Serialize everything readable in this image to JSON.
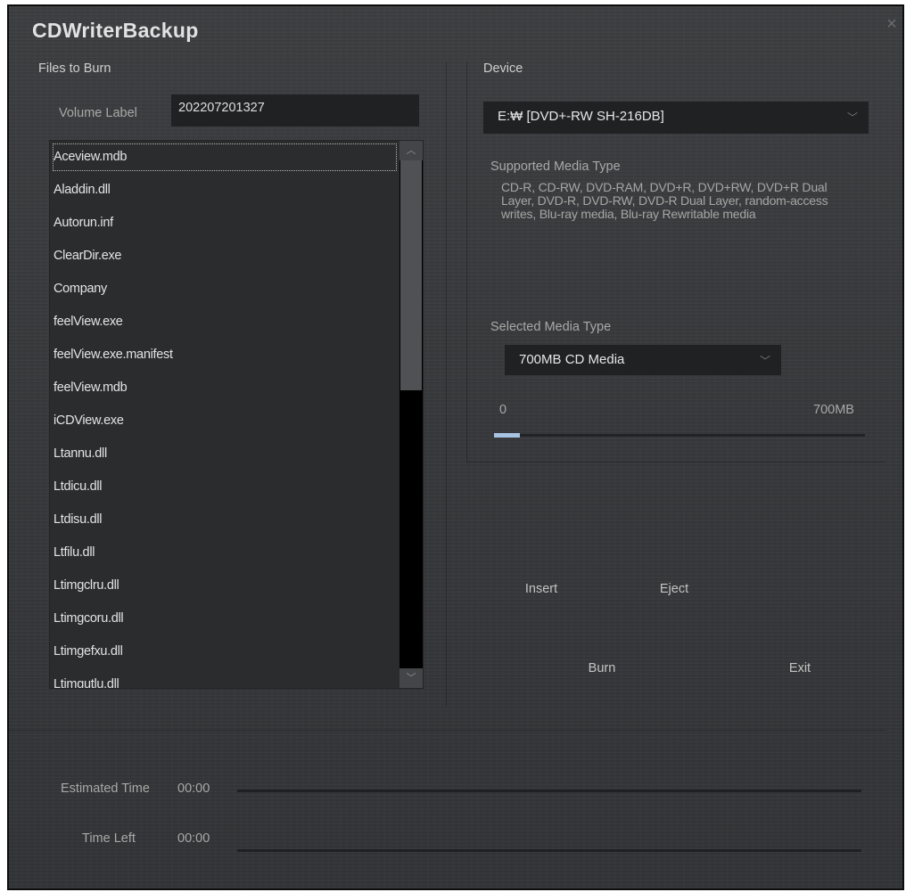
{
  "window": {
    "title": "CDWriterBackup",
    "close_glyph": "×"
  },
  "files": {
    "section_label": "Files to Burn",
    "volume_label": "Volume Label",
    "volume_value": "202207201327",
    "items": [
      "Aceview.mdb",
      "Aladdin.dll",
      "Autorun.inf",
      "ClearDir.exe",
      "Company",
      "feelView.exe",
      "feelView.exe.manifest",
      "feelView.mdb",
      "iCDView.exe",
      "Ltannu.dll",
      "Ltdicu.dll",
      "Ltdisu.dll",
      "Ltfilu.dll",
      "Ltimgclru.dll",
      "Ltimgcoru.dll",
      "Ltimgefxu.dll",
      "Ltimgutlu.dll"
    ],
    "scroll_up_glyph": "︿",
    "scroll_down_glyph": "﹀"
  },
  "device": {
    "section_label": "Device",
    "selected": "E:₩ [DVD+-RW SH-216DB]",
    "supported_label": "Supported Media Type",
    "supported_text": "CD-R, CD-RW, DVD-RAM, DVD+R, DVD+RW, DVD+R Dual Layer, DVD-R, DVD-RW, DVD-R Dual Layer, random-access writes, Blu-ray media, Blu-ray Rewritable media",
    "selected_media_label": "Selected Media Type",
    "selected_media": "700MB CD Media",
    "capacity_min": "0",
    "capacity_max": "700MB",
    "capacity_used_fraction": 0.07,
    "chevron_glyph": "﹀"
  },
  "buttons": {
    "insert": "Insert",
    "eject": "Eject",
    "burn": "Burn",
    "exit": "Exit"
  },
  "progress": {
    "estimated_label": "Estimated Time",
    "estimated_value": "00:00",
    "left_label": "Time Left",
    "left_value": "00:00"
  },
  "colors": {
    "background": "#38393c",
    "field": "#202123",
    "accent": "#a9c3e2"
  }
}
